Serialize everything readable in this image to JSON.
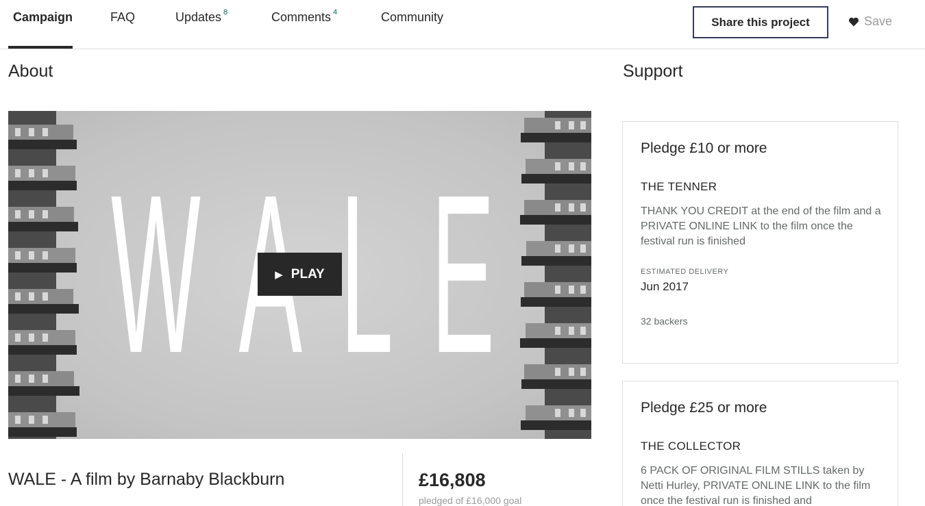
{
  "nav": {
    "tabs": [
      {
        "label": "Campaign",
        "count": ""
      },
      {
        "label": "FAQ",
        "count": ""
      },
      {
        "label": "Updates",
        "count": "8"
      },
      {
        "label": "Comments",
        "count": "4"
      },
      {
        "label": "Community",
        "count": ""
      }
    ],
    "active_tab": "Campaign",
    "share_label": "Share this project",
    "save_label": "Save"
  },
  "about": {
    "heading": "About",
    "video": {
      "title_letters": [
        "W",
        "A",
        "L",
        "E"
      ],
      "play_label": "PLAY"
    },
    "project_title": "WALE - A film by Barnaby Blackburn",
    "pledged_amount": "£16,808",
    "pledged_goal": "pledged of £16,000 goal"
  },
  "support": {
    "heading": "Support",
    "rewards": [
      {
        "pledge": "Pledge £10 or more",
        "title": "THE TENNER",
        "description": "THANK YOU CREDIT at the end of the film and a PRIVATE ONLINE LINK to the film once the festival run is finished",
        "delivery_label": "ESTIMATED DELIVERY",
        "delivery_value": "Jun 2017",
        "backers": "32 backers"
      },
      {
        "pledge": "Pledge £25 or more",
        "title": "THE COLLECTOR",
        "description": "6 PACK OF ORIGINAL FILM STILLS taken by Netti Hurley, PRIVATE ONLINE LINK to the film once the festival run is finished and"
      }
    ]
  },
  "colors": {
    "accent_green": "#037362",
    "text": "#282828",
    "muted": "#656969",
    "button_border": "#353a5c"
  }
}
